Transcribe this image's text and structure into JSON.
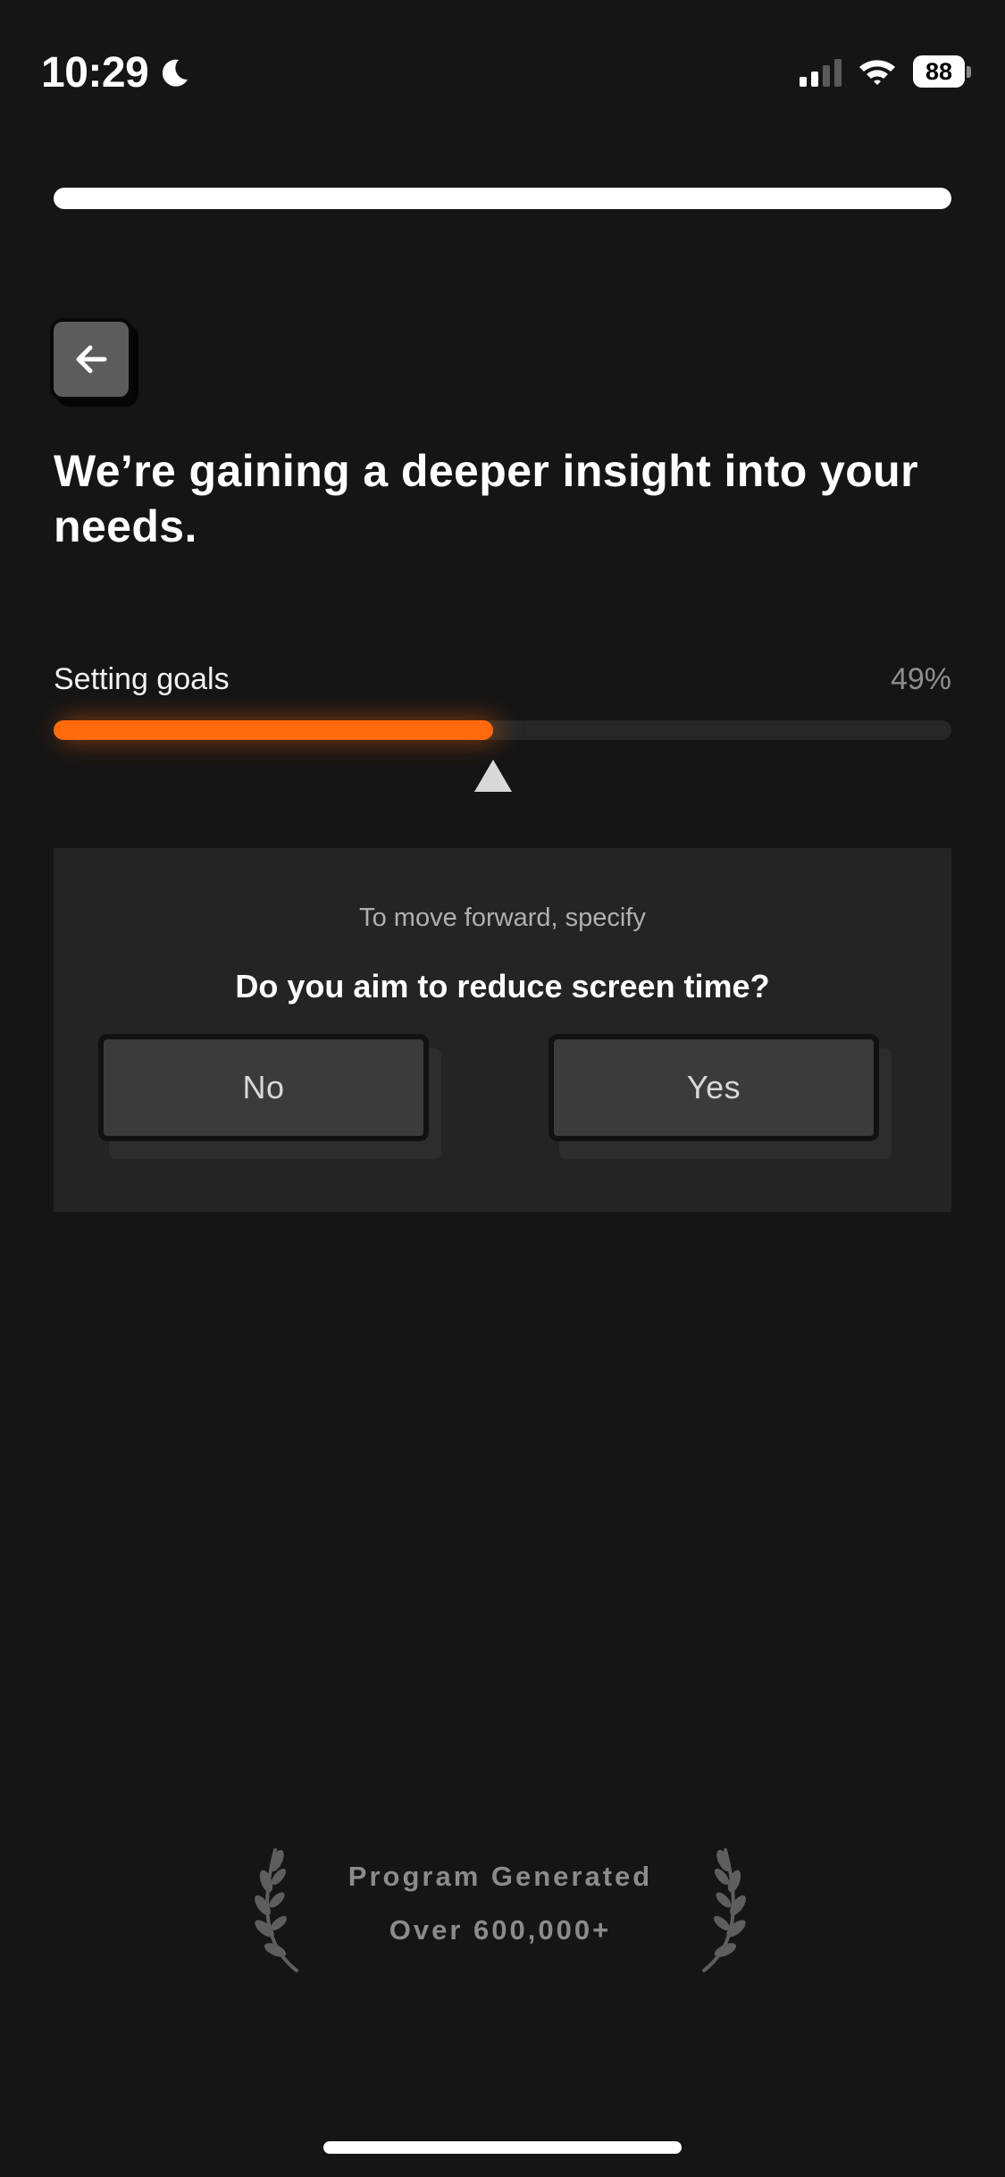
{
  "status_bar": {
    "time": "10:29",
    "focus_icon": "moon-icon",
    "signal_icon": "cellular-signal-icon",
    "wifi_icon": "wifi-icon",
    "battery_level": "88"
  },
  "onboarding": {
    "step_progress": 1.0,
    "back_icon": "arrow-left-icon"
  },
  "heading": "We’re gaining a deeper insight into your needs.",
  "analysis": {
    "label": "Setting goals",
    "percent_text": "49%",
    "progress": 0.49,
    "accent_color": "#ff6a0d"
  },
  "question": {
    "hint": "To move forward, specify",
    "text": "Do you aim to reduce screen time?",
    "options": {
      "no": "No",
      "yes": "Yes"
    }
  },
  "award": {
    "line1": "Program Generated",
    "line2": "Over 600,000+",
    "icon": "laurel-wreath-icon"
  }
}
